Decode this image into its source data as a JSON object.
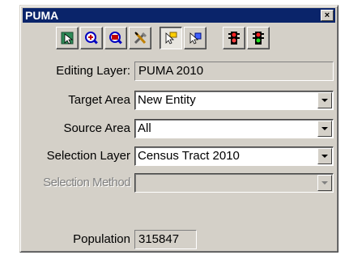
{
  "window": {
    "title": "PUMA",
    "close_glyph": "×"
  },
  "toolbar": {
    "buttons": [
      {
        "name": "select-features-icon",
        "pressed": false
      },
      {
        "name": "zoom-in-icon",
        "pressed": false
      },
      {
        "name": "zoom-to-selection-icon",
        "pressed": false
      },
      {
        "name": "tools-icon",
        "pressed": false
      },
      {
        "name": "pointer-select-icon",
        "pressed": true
      },
      {
        "name": "pointer-info-icon",
        "pressed": false
      },
      {
        "name": "traffic-light-red-icon",
        "pressed": false
      },
      {
        "name": "traffic-light-green-icon",
        "pressed": false
      }
    ]
  },
  "form": {
    "editing_layer": {
      "label": "Editing Layer:",
      "value": "PUMA 2010"
    },
    "target_area": {
      "label": "Target Area",
      "value": "New Entity"
    },
    "source_area": {
      "label": "Source Area",
      "value": "All"
    },
    "selection_layer": {
      "label": "Selection Layer",
      "value": "Census Tract 2010"
    },
    "selection_method": {
      "label": "Selection Method",
      "value": "",
      "disabled": true
    },
    "population": {
      "label": "Population",
      "value": "315847"
    }
  },
  "colors": {
    "title_bar": "#0a246a",
    "face": "#d4d0c8"
  }
}
